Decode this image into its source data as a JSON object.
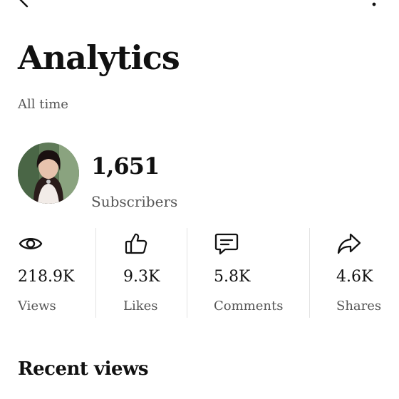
{
  "header": {
    "back_icon": "back-arrow-icon",
    "more_icon": "more-vert-icon",
    "title": "Analytics",
    "period": "All time"
  },
  "channel": {
    "subscribers_count": "1,651",
    "subscribers_label": "Subscribers"
  },
  "stats": [
    {
      "icon": "eye-icon",
      "value": "218.9K",
      "label": "Views"
    },
    {
      "icon": "thumbs-up-icon",
      "value": "9.3K",
      "label": "Likes"
    },
    {
      "icon": "comment-icon",
      "value": "5.8K",
      "label": "Comments"
    },
    {
      "icon": "share-icon",
      "value": "4.6K",
      "label": "Shares"
    }
  ],
  "sections": {
    "recent_views_title": "Recent views"
  }
}
